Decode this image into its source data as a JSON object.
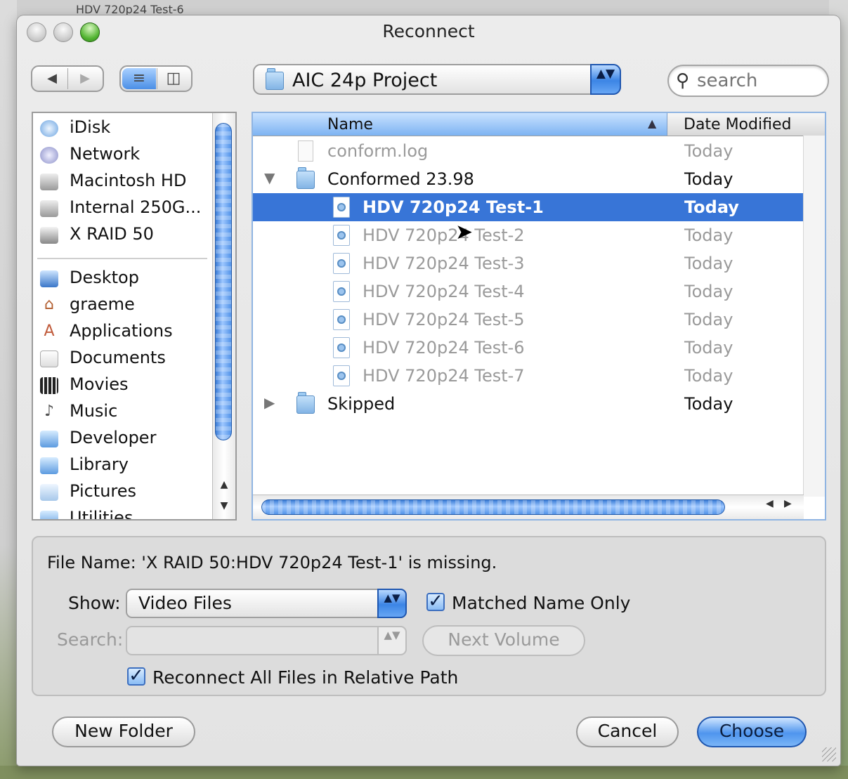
{
  "background": {
    "window_title_partial": "HDV 720p24 Test-6"
  },
  "window": {
    "title": "Reconnect"
  },
  "toolbar": {
    "back_icon": "triangle-left",
    "forward_icon": "triangle-right",
    "list_view_icon": "list-lines",
    "column_view_icon": "columns",
    "location_popup": {
      "label": "AIC 24p Project",
      "arrows": "▲▼"
    },
    "search": {
      "placeholder": "search",
      "value": ""
    }
  },
  "sidebar": {
    "devices": [
      {
        "label": "iDisk",
        "icon": "idisk-icon"
      },
      {
        "label": "Network",
        "icon": "network-icon"
      },
      {
        "label": "Macintosh HD",
        "icon": "hard-drive-icon"
      },
      {
        "label": "Internal 250G...",
        "icon": "hard-drive-icon"
      },
      {
        "label": "X RAID 50",
        "icon": "external-drive-icon"
      }
    ],
    "places": [
      {
        "label": "Desktop",
        "icon": "desktop-icon"
      },
      {
        "label": "graeme",
        "icon": "home-icon"
      },
      {
        "label": "Applications",
        "icon": "applications-icon"
      },
      {
        "label": "Documents",
        "icon": "documents-icon"
      },
      {
        "label": "Movies",
        "icon": "movies-icon"
      },
      {
        "label": "Music",
        "icon": "music-icon"
      },
      {
        "label": "Developer",
        "icon": "developer-icon"
      },
      {
        "label": "Library",
        "icon": "library-icon"
      },
      {
        "label": "Pictures",
        "icon": "pictures-icon"
      },
      {
        "label": "Utilities",
        "icon": "utilities-icon"
      }
    ]
  },
  "browser": {
    "columns": {
      "name": "Name",
      "date": "Date Modified",
      "sort": "▲"
    },
    "rows": [
      {
        "name": "conform.log",
        "date": "Today",
        "kind": "log",
        "state": "dim",
        "indent": 0
      },
      {
        "name": "Conformed 23.98",
        "date": "Today",
        "kind": "folder",
        "state": "normal",
        "expander": "▼",
        "indent": 0
      },
      {
        "name": "HDV 720p24 Test-1",
        "date": "Today",
        "kind": "movie",
        "state": "selected",
        "indent": 1
      },
      {
        "name": "HDV 720p24 Test-2",
        "date": "Today",
        "kind": "movie",
        "state": "dim",
        "indent": 1
      },
      {
        "name": "HDV 720p24 Test-3",
        "date": "Today",
        "kind": "movie",
        "state": "dim",
        "indent": 1
      },
      {
        "name": "HDV 720p24 Test-4",
        "date": "Today",
        "kind": "movie",
        "state": "dim",
        "indent": 1
      },
      {
        "name": "HDV 720p24 Test-5",
        "date": "Today",
        "kind": "movie",
        "state": "dim",
        "indent": 1
      },
      {
        "name": "HDV 720p24 Test-6",
        "date": "Today",
        "kind": "movie",
        "state": "dim",
        "indent": 1
      },
      {
        "name": "HDV 720p24 Test-7",
        "date": "Today",
        "kind": "movie",
        "state": "dim",
        "indent": 1
      },
      {
        "name": "Skipped",
        "date": "Today",
        "kind": "folder",
        "state": "normal",
        "expander": "▶",
        "indent": 0
      }
    ]
  },
  "options": {
    "status": "File Name: 'X RAID 50:HDV 720p24 Test-1' is missing.",
    "show_label": "Show:",
    "show_value": "Video Files",
    "matched_name_only": {
      "label": "Matched Name Only",
      "checked": true
    },
    "search_label": "Search:",
    "search_value": "",
    "next_volume": "Next Volume",
    "reconnect_all": {
      "label": "Reconnect All Files in Relative Path",
      "checked": true
    }
  },
  "buttons": {
    "new_folder": "New Folder",
    "cancel": "Cancel",
    "choose": "Choose"
  },
  "colors": {
    "selection": "#3875d7",
    "accent": "#3c85e5"
  }
}
